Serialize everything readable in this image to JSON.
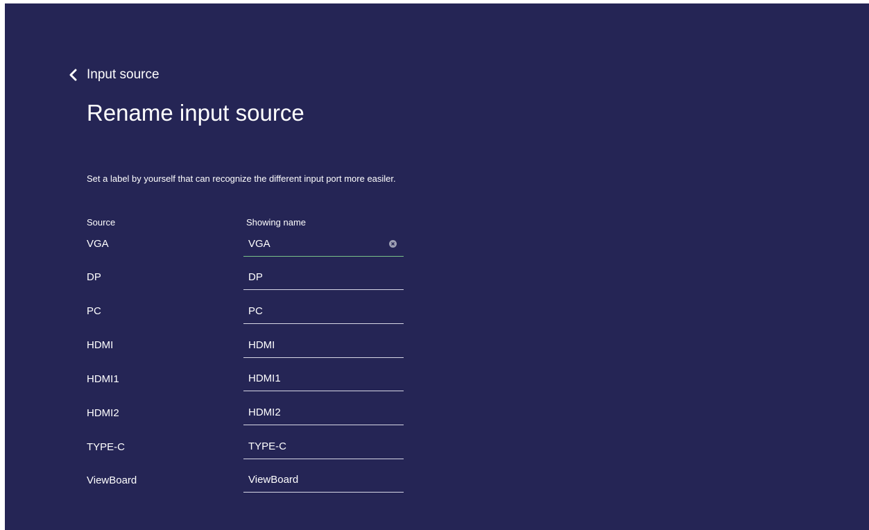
{
  "header": {
    "back_label": "Input source",
    "title": "Rename input source"
  },
  "description": "Set a label by yourself that can recognize the different input port more easiler.",
  "columns": {
    "source": "Source",
    "showing_name": "Showing name"
  },
  "rows": [
    {
      "source": "VGA",
      "name": "VGA"
    },
    {
      "source": "DP",
      "name": "DP"
    },
    {
      "source": "PC",
      "name": "PC"
    },
    {
      "source": "HDMI",
      "name": "HDMI"
    },
    {
      "source": "HDMI1",
      "name": "HDMI1"
    },
    {
      "source": "HDMI2",
      "name": "HDMI2"
    },
    {
      "source": "TYPE-C",
      "name": "TYPE-C"
    },
    {
      "source": "ViewBoard",
      "name": "ViewBoard"
    }
  ],
  "colors": {
    "background": "#252555",
    "focus_underline": "#7ac28a",
    "underline": "#d8d8e6"
  },
  "icons": {
    "back": "chevron-left-icon",
    "clear": "clear-circle-icon"
  }
}
